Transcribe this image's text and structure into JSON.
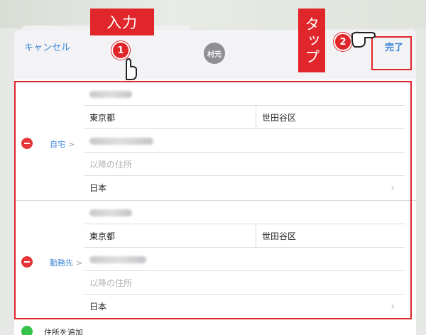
{
  "nav": {
    "cancel_label": "キャンセル",
    "avatar_text": "村元",
    "done_label": "完了"
  },
  "annotations": {
    "step1_label": "入力",
    "step1_number": "1",
    "step2_label": "タップ",
    "step2_number": "2"
  },
  "addresses": [
    {
      "type_label": "自宅",
      "chevron": ">",
      "prefecture": "東京都",
      "city": "世田谷区",
      "more_placeholder": "以降の住所",
      "country": "日本"
    },
    {
      "type_label": "勤務先",
      "chevron": ">",
      "prefecture": "東京都",
      "city": "世田谷区",
      "more_placeholder": "以降の住所",
      "country": "日本"
    }
  ],
  "add_address_label": "住所を追加",
  "colors": {
    "accent_blue": "#3a84d6",
    "annotation_red": "#e0262a",
    "delete_red": "#e6363a",
    "add_green": "#34c24a"
  }
}
